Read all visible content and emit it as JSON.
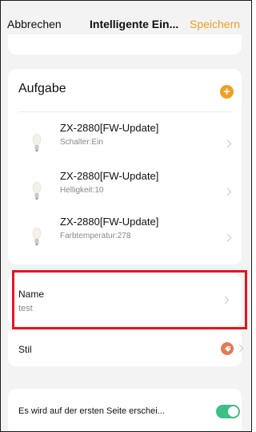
{
  "header": {
    "cancel_label": "Abbrechen",
    "title": "Intelligente Ein...",
    "save_label": "Speichern"
  },
  "tasks": {
    "heading": "Aufgabe",
    "add_icon": "plus-icon",
    "items": [
      {
        "name": "ZX-2880[FW-Update]",
        "detail": "Schalter:Ein",
        "icon": "bulb-icon"
      },
      {
        "name": "ZX-2880[FW-Update]",
        "detail": "Helligkeit:10",
        "icon": "bulb-icon"
      },
      {
        "name": "ZX-2880[FW-Update]",
        "detail": "Farbtemperatur:278",
        "icon": "bulb-icon"
      }
    ]
  },
  "name_field": {
    "label": "Name",
    "value": "test"
  },
  "style_field": {
    "label": "Stil",
    "icon": "tag-icon"
  },
  "toggle_field": {
    "label": "Es wird auf der ersten Seite erschei...",
    "enabled": true
  },
  "colors": {
    "accent": "#f0a020",
    "toggle_on": "#3dbf86",
    "highlight": "#e3161f",
    "style_icon": "#e47a57"
  }
}
